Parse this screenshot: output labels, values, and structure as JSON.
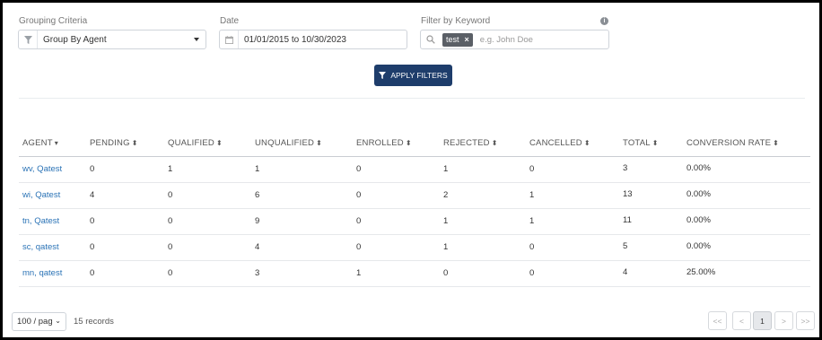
{
  "filters": {
    "grouping": {
      "label": "Grouping Criteria",
      "value": "Group By Agent"
    },
    "date": {
      "label": "Date",
      "value": "01/01/2015 to 10/30/2023"
    },
    "keyword": {
      "label": "Filter by Keyword",
      "tag": "test",
      "placeholder": "e.g. John Doe"
    },
    "apply_label": "APPLY FILTERS"
  },
  "table": {
    "headers": [
      "AGENT",
      "PENDING",
      "QUALIFIED",
      "UNQUALIFIED",
      "ENROLLED",
      "REJECTED",
      "CANCELLED",
      "TOTAL",
      "CONVERSION RATE"
    ],
    "rows": [
      [
        "wv, Qatest",
        "0",
        "1",
        "1",
        "0",
        "1",
        "0",
        "3",
        "0.00%"
      ],
      [
        "wi, Qatest",
        "4",
        "0",
        "6",
        "0",
        "2",
        "1",
        "13",
        "0.00%"
      ],
      [
        "tn, Qatest",
        "0",
        "0",
        "9",
        "0",
        "1",
        "1",
        "11",
        "0.00%"
      ],
      [
        "sc, qatest",
        "0",
        "0",
        "4",
        "0",
        "1",
        "0",
        "5",
        "0.00%"
      ],
      [
        "mn, qatest",
        "0",
        "0",
        "3",
        "1",
        "0",
        "0",
        "4",
        "25.00%"
      ]
    ]
  },
  "pagination": {
    "page_size": "100 / pag",
    "records": "15 records",
    "first": "<<",
    "prev": "<",
    "current": "1",
    "next": ">",
    "last": ">>"
  }
}
